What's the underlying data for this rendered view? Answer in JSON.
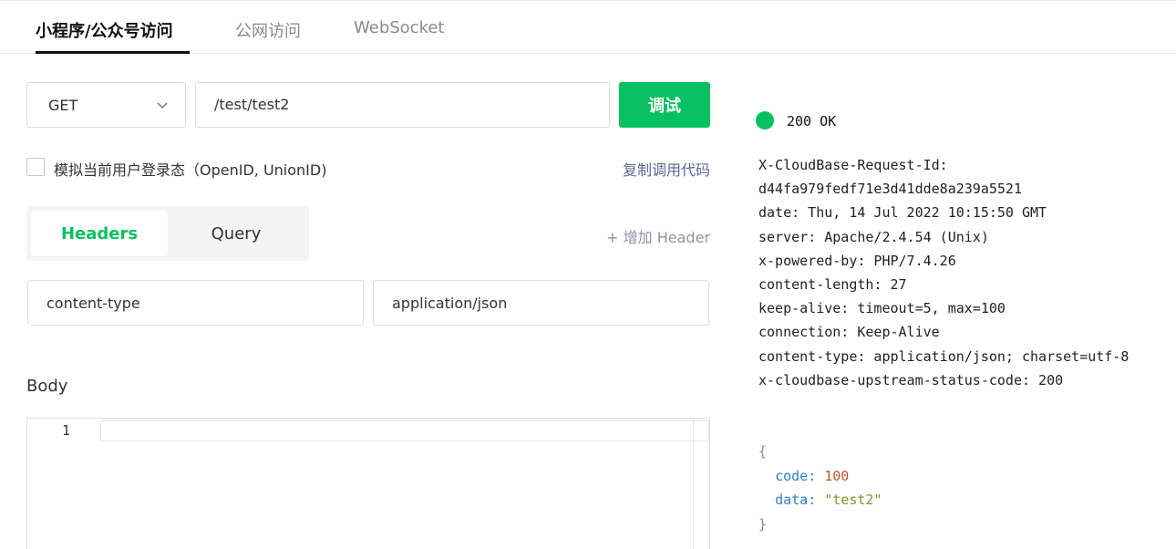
{
  "tabs": [
    {
      "label": "小程序/公众号访问",
      "active": true
    },
    {
      "label": "公网访问",
      "active": false
    },
    {
      "label": "WebSocket",
      "active": false
    }
  ],
  "request": {
    "method": "GET",
    "path": "/test/test2",
    "debug_button": "调试"
  },
  "simulate_login_label": "模拟当前用户登录态（OpenID, UnionID)",
  "copy_code_label": "复制调用代码",
  "param_tabs": {
    "headers": "Headers",
    "query": "Query"
  },
  "add_header_label": "+ 增加 Header",
  "header_row": {
    "key": "content-type",
    "value": "application/json"
  },
  "body_label": "Body",
  "editor": {
    "line_number": "1"
  },
  "response": {
    "status": "200 OK",
    "headers": [
      "X-CloudBase-Request-Id:",
      "d44fa979fedf71e3d41dde8a239a5521",
      "date: Thu, 14 Jul 2022 10:15:50 GMT",
      "server: Apache/2.4.54 (Unix)",
      "x-powered-by: PHP/7.4.26",
      "content-length: 27",
      "keep-alive: timeout=5, max=100",
      "connection: Keep-Alive",
      "content-type: application/json; charset=utf-8",
      "x-cloudbase-upstream-status-code: 200"
    ],
    "json": {
      "open": "{",
      "code_key": "code:",
      "code_val": "100",
      "data_key": "data:",
      "data_val": "\"test2\"",
      "close": "}"
    }
  },
  "colors": {
    "accent": "#07c160",
    "link": "#576b95"
  }
}
